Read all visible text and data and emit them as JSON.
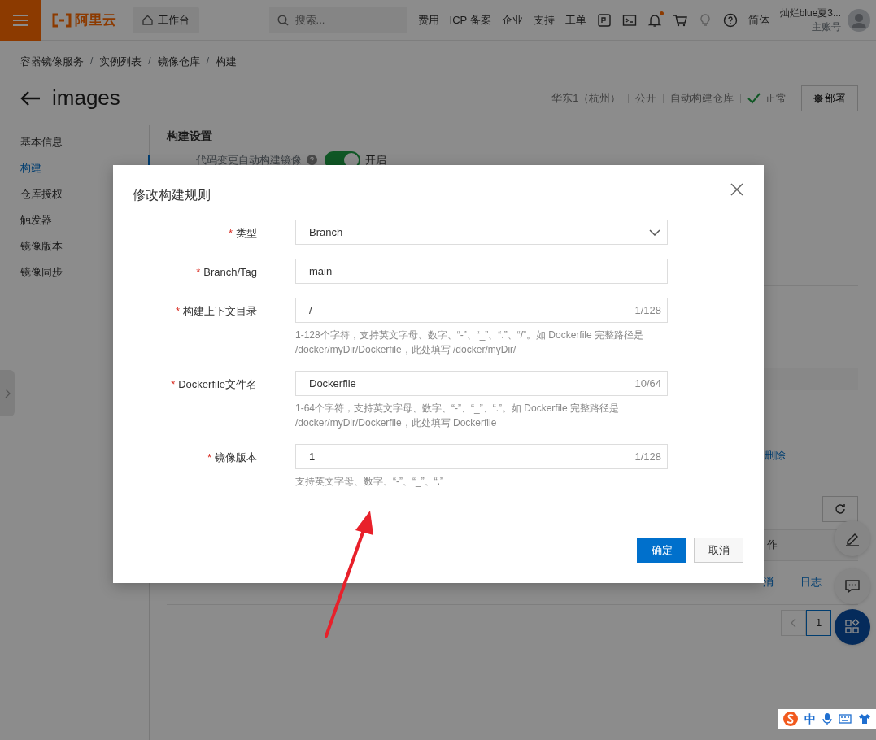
{
  "top_bar": {
    "logo_text": "阿里云",
    "workbench": "工作台",
    "search": {
      "placeholder": "搜索..."
    },
    "nav_links": [
      "费用",
      "ICP 备案",
      "企业",
      "支持",
      "工单"
    ],
    "toolbar_icons": [
      {
        "kind": "api",
        "unread": false
      },
      {
        "kind": "terminal",
        "unread": false
      },
      {
        "kind": "bell",
        "unread": true
      },
      {
        "kind": "cart",
        "unread": false
      },
      {
        "kind": "bulb",
        "unread": false
      },
      {
        "kind": "help",
        "unread": false
      }
    ],
    "language": "简体",
    "user": {
      "name": "灿烂blue夏3...",
      "role": "主账号"
    }
  },
  "breadcrumb": {
    "items": [
      "容器镜像服务",
      "实例列表",
      "镜像仓库",
      "构建"
    ],
    "separator": "/"
  },
  "header": {
    "title": "images",
    "tags": [
      "华东1（杭州）",
      "公开",
      "自动构建仓库"
    ],
    "status": "正常",
    "deploy_button": "部署"
  },
  "sidebar": {
    "items": [
      {
        "label": "基本信息",
        "selected": false
      },
      {
        "label": "构建",
        "selected": true
      },
      {
        "label": "仓库授权",
        "selected": false
      },
      {
        "label": "触发器",
        "selected": false
      },
      {
        "label": "镜像版本",
        "selected": false
      },
      {
        "label": "镜像同步",
        "selected": false
      }
    ]
  },
  "build_settings": {
    "heading": "构建设置",
    "auto_build": {
      "label": "代码变更自动构建镜像",
      "on": true,
      "state_text": "开启"
    }
  },
  "background_table": {
    "delete_link": "删除",
    "column_header": "作",
    "action_links": [
      "消",
      "日志"
    ],
    "pages": [
      {
        "label": "1",
        "selected": true
      }
    ]
  },
  "dialog": {
    "title": "修改构建规则",
    "fields": [
      {
        "kind": "select",
        "label": "类型",
        "required_mark": "*",
        "value": "Branch"
      },
      {
        "kind": "text",
        "label": "Branch/Tag",
        "required_mark": "*",
        "value": "main"
      },
      {
        "kind": "text",
        "label": "构建上下文目录",
        "required_mark": "*",
        "value": "/",
        "counter": "1/128",
        "help": "1-128个字符，支持英文字母、数字、“-”、“_”、“.”、“/”。如 Dockerfile 完整路径是 /docker/myDir/Dockerfile，此处填写 /docker/myDir/"
      },
      {
        "kind": "text",
        "label": "Dockerfile文件名",
        "required_mark": "*",
        "value": "Dockerfile",
        "counter": "10/64",
        "help": "1-64个字符，支持英文字母、数字、“-”、“_”、“.”。如 Dockerfile 完整路径是 /docker/myDir/Dockerfile，此处填写 Dockerfile"
      },
      {
        "kind": "text",
        "label": "镜像版本",
        "required_mark": "*",
        "value": "1",
        "counter": "1/128",
        "help": "支持英文字母、数字、“-”、“_”、“.”"
      }
    ],
    "buttons": [
      {
        "label": "确定",
        "kind": "primary"
      },
      {
        "label": "取消",
        "kind": "secondary"
      }
    ]
  },
  "ime_toolbar": {
    "mode": "中"
  }
}
